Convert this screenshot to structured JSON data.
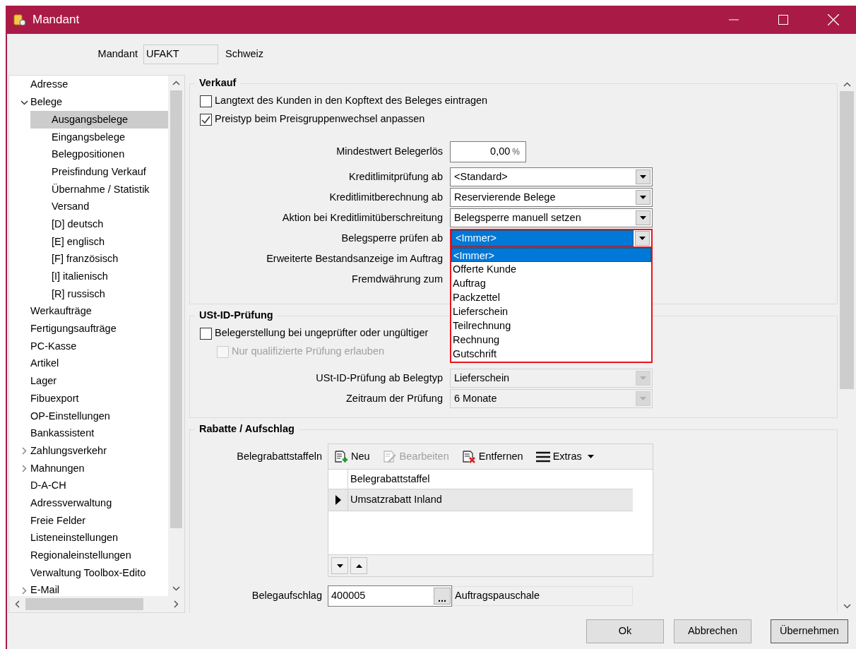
{
  "window": {
    "title": "Mandant"
  },
  "mandant": {
    "label": "Mandant",
    "value": "UFAKT",
    "country": "Schweiz"
  },
  "tree": {
    "items": [
      {
        "label": "Adresse",
        "selected": false
      },
      {
        "label": "Belege",
        "selected": false,
        "expanded": true,
        "children": [
          {
            "label": "Ausgangsbelege",
            "selected": true
          },
          {
            "label": "Eingangsbelege",
            "selected": false
          },
          {
            "label": "Belegpositionen",
            "selected": false
          },
          {
            "label": "Preisfindung Verkauf",
            "selected": false
          },
          {
            "label": "Übernahme / Statistik",
            "selected": false
          },
          {
            "label": "Versand",
            "selected": false
          },
          {
            "label": "[D] deutsch",
            "selected": false
          },
          {
            "label": "[E] englisch",
            "selected": false
          },
          {
            "label": "[F] französisch",
            "selected": false
          },
          {
            "label": "[I] italienisch",
            "selected": false
          },
          {
            "label": "[R] russisch",
            "selected": false
          }
        ]
      },
      {
        "label": "Werkaufträge",
        "selected": false
      },
      {
        "label": "Fertigungsaufträge",
        "selected": false
      },
      {
        "label": "PC-Kasse",
        "selected": false
      },
      {
        "label": "Artikel",
        "selected": false
      },
      {
        "label": "Lager",
        "selected": false
      },
      {
        "label": "Fibuexport",
        "selected": false
      },
      {
        "label": "OP-Einstellungen",
        "selected": false
      },
      {
        "label": "Bankassistent",
        "selected": false
      },
      {
        "label": "Zahlungsverkehr",
        "selected": false,
        "expanded": false
      },
      {
        "label": "Mahnungen",
        "selected": false,
        "expanded": false
      },
      {
        "label": "D-A-CH",
        "selected": false
      },
      {
        "label": "Adressverwaltung",
        "selected": false
      },
      {
        "label": "Freie Felder",
        "selected": false
      },
      {
        "label": "Listeneinstellungen",
        "selected": false
      },
      {
        "label": "Regionaleinstellungen",
        "selected": false
      },
      {
        "label": "Verwaltung Toolbox-Edito",
        "selected": false
      },
      {
        "label": "E-Mail",
        "selected": false,
        "expanded": false
      }
    ]
  },
  "verkauf": {
    "title": "Verkauf",
    "checkboxes": [
      {
        "label": "Langtext des Kunden in den Kopftext des Beleges eintragen",
        "checked": false,
        "disabled": false
      },
      {
        "label": "Preistyp beim Preisgruppenwechsel anpassen",
        "checked": true,
        "disabled": false
      }
    ],
    "fields": [
      {
        "label": "Mindestwert Belegerlös",
        "kind": "spin",
        "value": "0,00",
        "unit": "%"
      },
      {
        "label": "Kreditlimitprüfung ab",
        "kind": "combo",
        "value": "<Standard>",
        "focused": false,
        "disabled": false
      },
      {
        "label": "Kreditlimitberechnung ab",
        "kind": "combo",
        "value": "Reservierende Belege",
        "focused": false,
        "disabled": false
      },
      {
        "label": "Aktion bei Kreditlimitüberschreitung",
        "kind": "combo",
        "value": "Belegsperre manuell setzen",
        "focused": false,
        "disabled": false
      },
      {
        "label": "Belegsperre prüfen ab",
        "kind": "combo",
        "value": "<Immer>",
        "focused": true,
        "disabled": false,
        "open": true,
        "options": [
          {
            "label": "<Immer>",
            "selected": true
          },
          {
            "label": "Offerte Kunde",
            "selected": false
          },
          {
            "label": "Auftrag",
            "selected": false
          },
          {
            "label": "Packzettel",
            "selected": false
          },
          {
            "label": "Lieferschein",
            "selected": false
          },
          {
            "label": "Teilrechnung",
            "selected": false
          },
          {
            "label": "Rechnung",
            "selected": false
          },
          {
            "label": "Gutschrift",
            "selected": false
          }
        ]
      },
      {
        "label": "Erweiterte Bestandsanzeige im Auftrag",
        "kind": "covered"
      },
      {
        "label": "Fremdwährung zum",
        "kind": "covered"
      }
    ]
  },
  "ust": {
    "title": "USt-ID-Prüfung",
    "checkboxes": [
      {
        "label": "Belegerstellung bei ungeprüfter oder ungültiger",
        "checked": false,
        "disabled": false,
        "children": [
          {
            "label": "Nur qualifizierte Prüfung erlauben",
            "checked": false,
            "disabled": true
          }
        ]
      }
    ],
    "fields": [
      {
        "label": "USt-ID-Prüfung ab Belegtyp",
        "kind": "combo",
        "value": "Lieferschein",
        "focused": false,
        "disabled": true
      },
      {
        "label": "Zeitraum der Prüfung",
        "kind": "combo",
        "value": "6 Monate",
        "focused": false,
        "disabled": true
      }
    ]
  },
  "rabatte": {
    "title": "Rabatte / Aufschlag",
    "staffeln": {
      "label": "Belegrabattstaffeln",
      "toolbar": [
        {
          "label": "Neu",
          "kind": "new",
          "disabled": false
        },
        {
          "label": "Bearbeiten",
          "kind": "edit",
          "disabled": true
        },
        {
          "label": "Entfernen",
          "kind": "delete",
          "disabled": false
        },
        {
          "label": "Extras",
          "kind": "menu",
          "disabled": false
        }
      ],
      "columns": [
        "Belegrabattstaffel"
      ],
      "rows": [
        {
          "cells": [
            "Umsatzrabatt Inland"
          ],
          "selected": true
        }
      ]
    },
    "aufschlag": {
      "label": "Belegaufschlag",
      "value": "400005",
      "button": "...",
      "description": "Auftragspauschale"
    }
  },
  "buttons": [
    {
      "label": "Ok",
      "focused": false
    },
    {
      "label": "Abbrechen",
      "focused": false
    },
    {
      "label": "Übernehmen",
      "focused": true
    }
  ]
}
